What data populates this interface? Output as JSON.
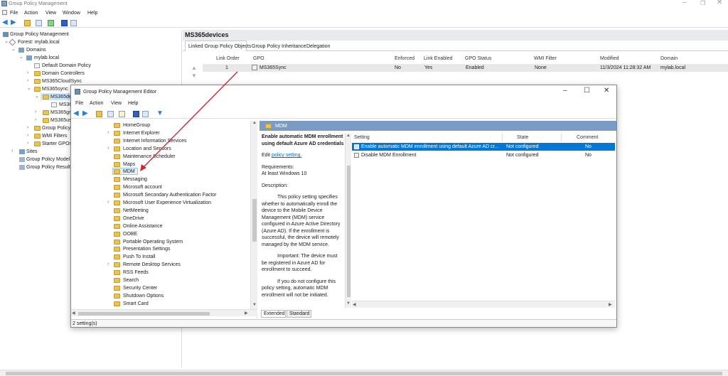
{
  "main_window": {
    "title": "Group Policy Management",
    "menu": [
      "File",
      "Action",
      "View",
      "Window",
      "Help"
    ]
  },
  "tree": {
    "root": "Group Policy Management",
    "forest": "Forest: mylab.local",
    "domains": "Domains",
    "domain": "mylab.local",
    "items": [
      "Default Domain Policy",
      "Domain Controllers",
      "MS365CloudSync",
      "MS365sync"
    ],
    "ms365sync_child": "MS365de",
    "ms365sync_grandchild": "MS36",
    "more_items": [
      "MS365gr",
      "MS365us"
    ],
    "group_policy": "Group Policy",
    "wmi_filters": "WMI Filters",
    "starter_gpos": "Starter GPOs",
    "sites": "Sites",
    "modeling": "Group Policy Model",
    "results": "Group Policy Result"
  },
  "right_panel": {
    "title": "MS365devices",
    "tabs": [
      "Linked Group Policy Objects",
      "Group Policy Inheritance",
      "Delegation"
    ],
    "columns": [
      "Link Order",
      "GPO",
      "Enforced",
      "Link Enabled",
      "GPO Status",
      "WMI Filter",
      "Modified",
      "Domain"
    ],
    "row": {
      "link_order": "1",
      "gpo": "MS365Sync",
      "enforced": "No",
      "link_enabled": "Yes",
      "gpo_status": "Enabled",
      "wmi_filter": "None",
      "modified": "11/3/2024 11:28:32 AM",
      "domain": "mylab.local"
    }
  },
  "editor": {
    "title": "Group Policy Management Editor",
    "menu": [
      "File",
      "Action",
      "View",
      "Help"
    ],
    "folders": [
      "HomeGroup",
      "Internet Explorer",
      "Internet Information Services",
      "Location and Sensors",
      "Maintenance Scheduler",
      "Maps",
      "MDM",
      "Messaging",
      "Microsoft account",
      "Microsoft Secondary Authentication Factor",
      "Microsoft User Experience Virtualization",
      "NetMeeting",
      "OneDrive",
      "Online Assistance",
      "OOBE",
      "Portable Operating System",
      "Presentation Settings",
      "Push To Install",
      "Remote Desktop Services",
      "RSS Feeds",
      "Search",
      "Security Center",
      "Shutdown Options",
      "Smart Card"
    ],
    "expandable": [
      false,
      true,
      false,
      true,
      false,
      false,
      false,
      false,
      false,
      false,
      true,
      false,
      false,
      false,
      false,
      false,
      false,
      false,
      true,
      false,
      false,
      false,
      false,
      false
    ],
    "header_folder": "MDM",
    "desc_title": "Enable automatic MDM enrollment using default Azure AD credentials",
    "edit_prefix": "Edit ",
    "edit_link": "policy setting.",
    "requirements_label": "Requirements:",
    "requirements_value": "At least Windows 10",
    "description_label": "Description:",
    "desc_p1": "This policy setting specifies whether to automatically enroll the device to the Mobile Device Management (MDM) service configured in Azure Active Directory (Azure AD). If the enrollment is successful, the device will remotely managed by the MDM service.",
    "desc_p2": "Important: The device must be registered in Azure AD for enrollment to succeed.",
    "desc_p3": "If you do not configure this policy setting, automatic MDM enrollment will not be initiated.",
    "columns": [
      "Setting",
      "State",
      "Comment"
    ],
    "settings": [
      {
        "name": "Enable automatic MDM enrollment using default Azure AD cr...",
        "state": "Not configured",
        "comment": "No"
      },
      {
        "name": "Disable MDM Enrollment",
        "state": "Not configured",
        "comment": "No"
      }
    ],
    "bottom_tabs": [
      "Extended",
      "Standard"
    ],
    "status": "2 setting(s)"
  },
  "colors": {
    "selection": "#0078d7",
    "tree_selection": "#cce8ff",
    "arrow": "#d0262e",
    "link": "#0066cc"
  }
}
